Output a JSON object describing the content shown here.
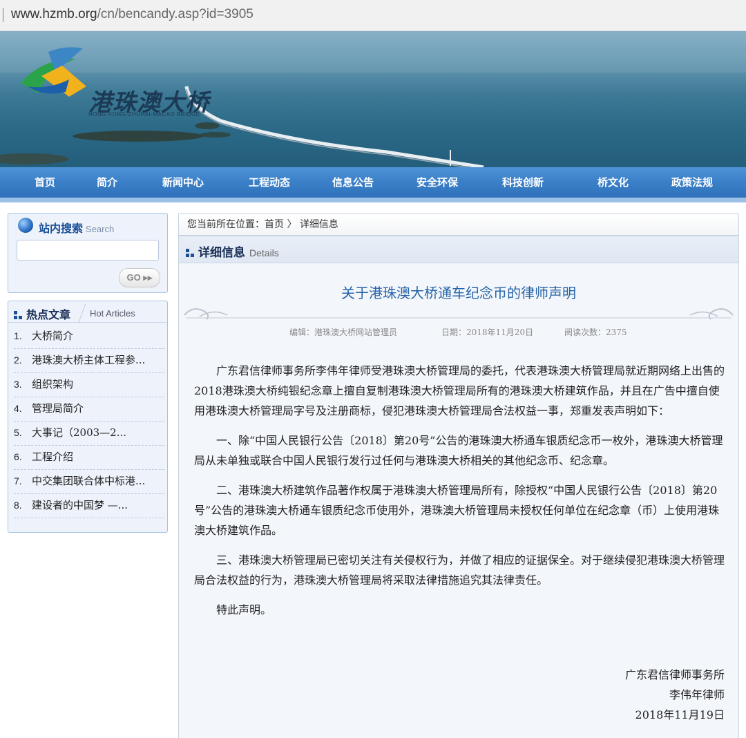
{
  "url": {
    "domain": "www.hzmb.org",
    "path": "/cn/bencandy.asp?id=3905"
  },
  "logo": {
    "cn": "港珠澳大桥",
    "en": "HONG KONG-ZHUHAI-MACAO BRIDGE"
  },
  "nav": [
    "首页",
    "简介",
    "新闻中心",
    "工程动态",
    "信息公告",
    "安全环保",
    "科技创新",
    "桥文化",
    "政策法规"
  ],
  "search": {
    "title": "站内搜索",
    "title_en": "Search",
    "input_value": "",
    "go_label": "GO"
  },
  "hot": {
    "title": "热点文章",
    "title_en": "Hot Articles",
    "items": [
      {
        "num": "1.",
        "label": "大桥简介"
      },
      {
        "num": "2.",
        "label": "港珠澳大桥主体工程参..."
      },
      {
        "num": "3.",
        "label": "组织架构"
      },
      {
        "num": "4.",
        "label": "管理局简介"
      },
      {
        "num": "5.",
        "label": "大事记（2003—2..."
      },
      {
        "num": "6.",
        "label": "工程介绍"
      },
      {
        "num": "7.",
        "label": "中交集团联合体中标港..."
      },
      {
        "num": "8.",
        "label": "建设者的中国梦 —..."
      }
    ]
  },
  "breadcrumb": "您当前所在位置：首页 〉 详细信息",
  "panel": {
    "title": "详细信息",
    "title_en": "Details"
  },
  "article": {
    "title": "关于港珠澳大桥通车纪念币的律师声明",
    "editor": "编辑：港珠澳大桥网站管理员",
    "date": "日期：2018年11月20日",
    "views": "阅读次数：2375",
    "paragraphs": [
      "广东君信律师事务所李伟年律师受港珠澳大桥管理局的委托，代表港珠澳大桥管理局就近期网络上出售的2018港珠澳大桥纯银纪念章上擅自复制港珠澳大桥管理局所有的港珠澳大桥建筑作品，并且在广告中擅自使用港珠澳大桥管理局字号及注册商标，侵犯港珠澳大桥管理局合法权益一事，郑重发表声明如下：",
      "一、除“中国人民银行公告〔2018〕第20号”公告的港珠澳大桥通车银质纪念币一枚外，港珠澳大桥管理局从未单独或联合中国人民银行发行过任何与港珠澳大桥相关的其他纪念币、纪念章。",
      "二、港珠澳大桥建筑作品著作权属于港珠澳大桥管理局所有，除授权“中国人民银行公告〔2018〕第20号”公告的港珠澳大桥通车银质纪念币使用外，港珠澳大桥管理局未授权任何单位在纪念章（币）上使用港珠澳大桥建筑作品。",
      "三、港珠澳大桥管理局已密切关注有关侵权行为，并做了相应的证据保全。对于继续侵犯港珠澳大桥管理局合法权益的行为，港珠澳大桥管理局将采取法律措施追究其法律责任。",
      "特此声明。"
    ],
    "sign": [
      "广东君信律师事务所",
      "李伟年律师",
      "2018年11月19日"
    ]
  }
}
